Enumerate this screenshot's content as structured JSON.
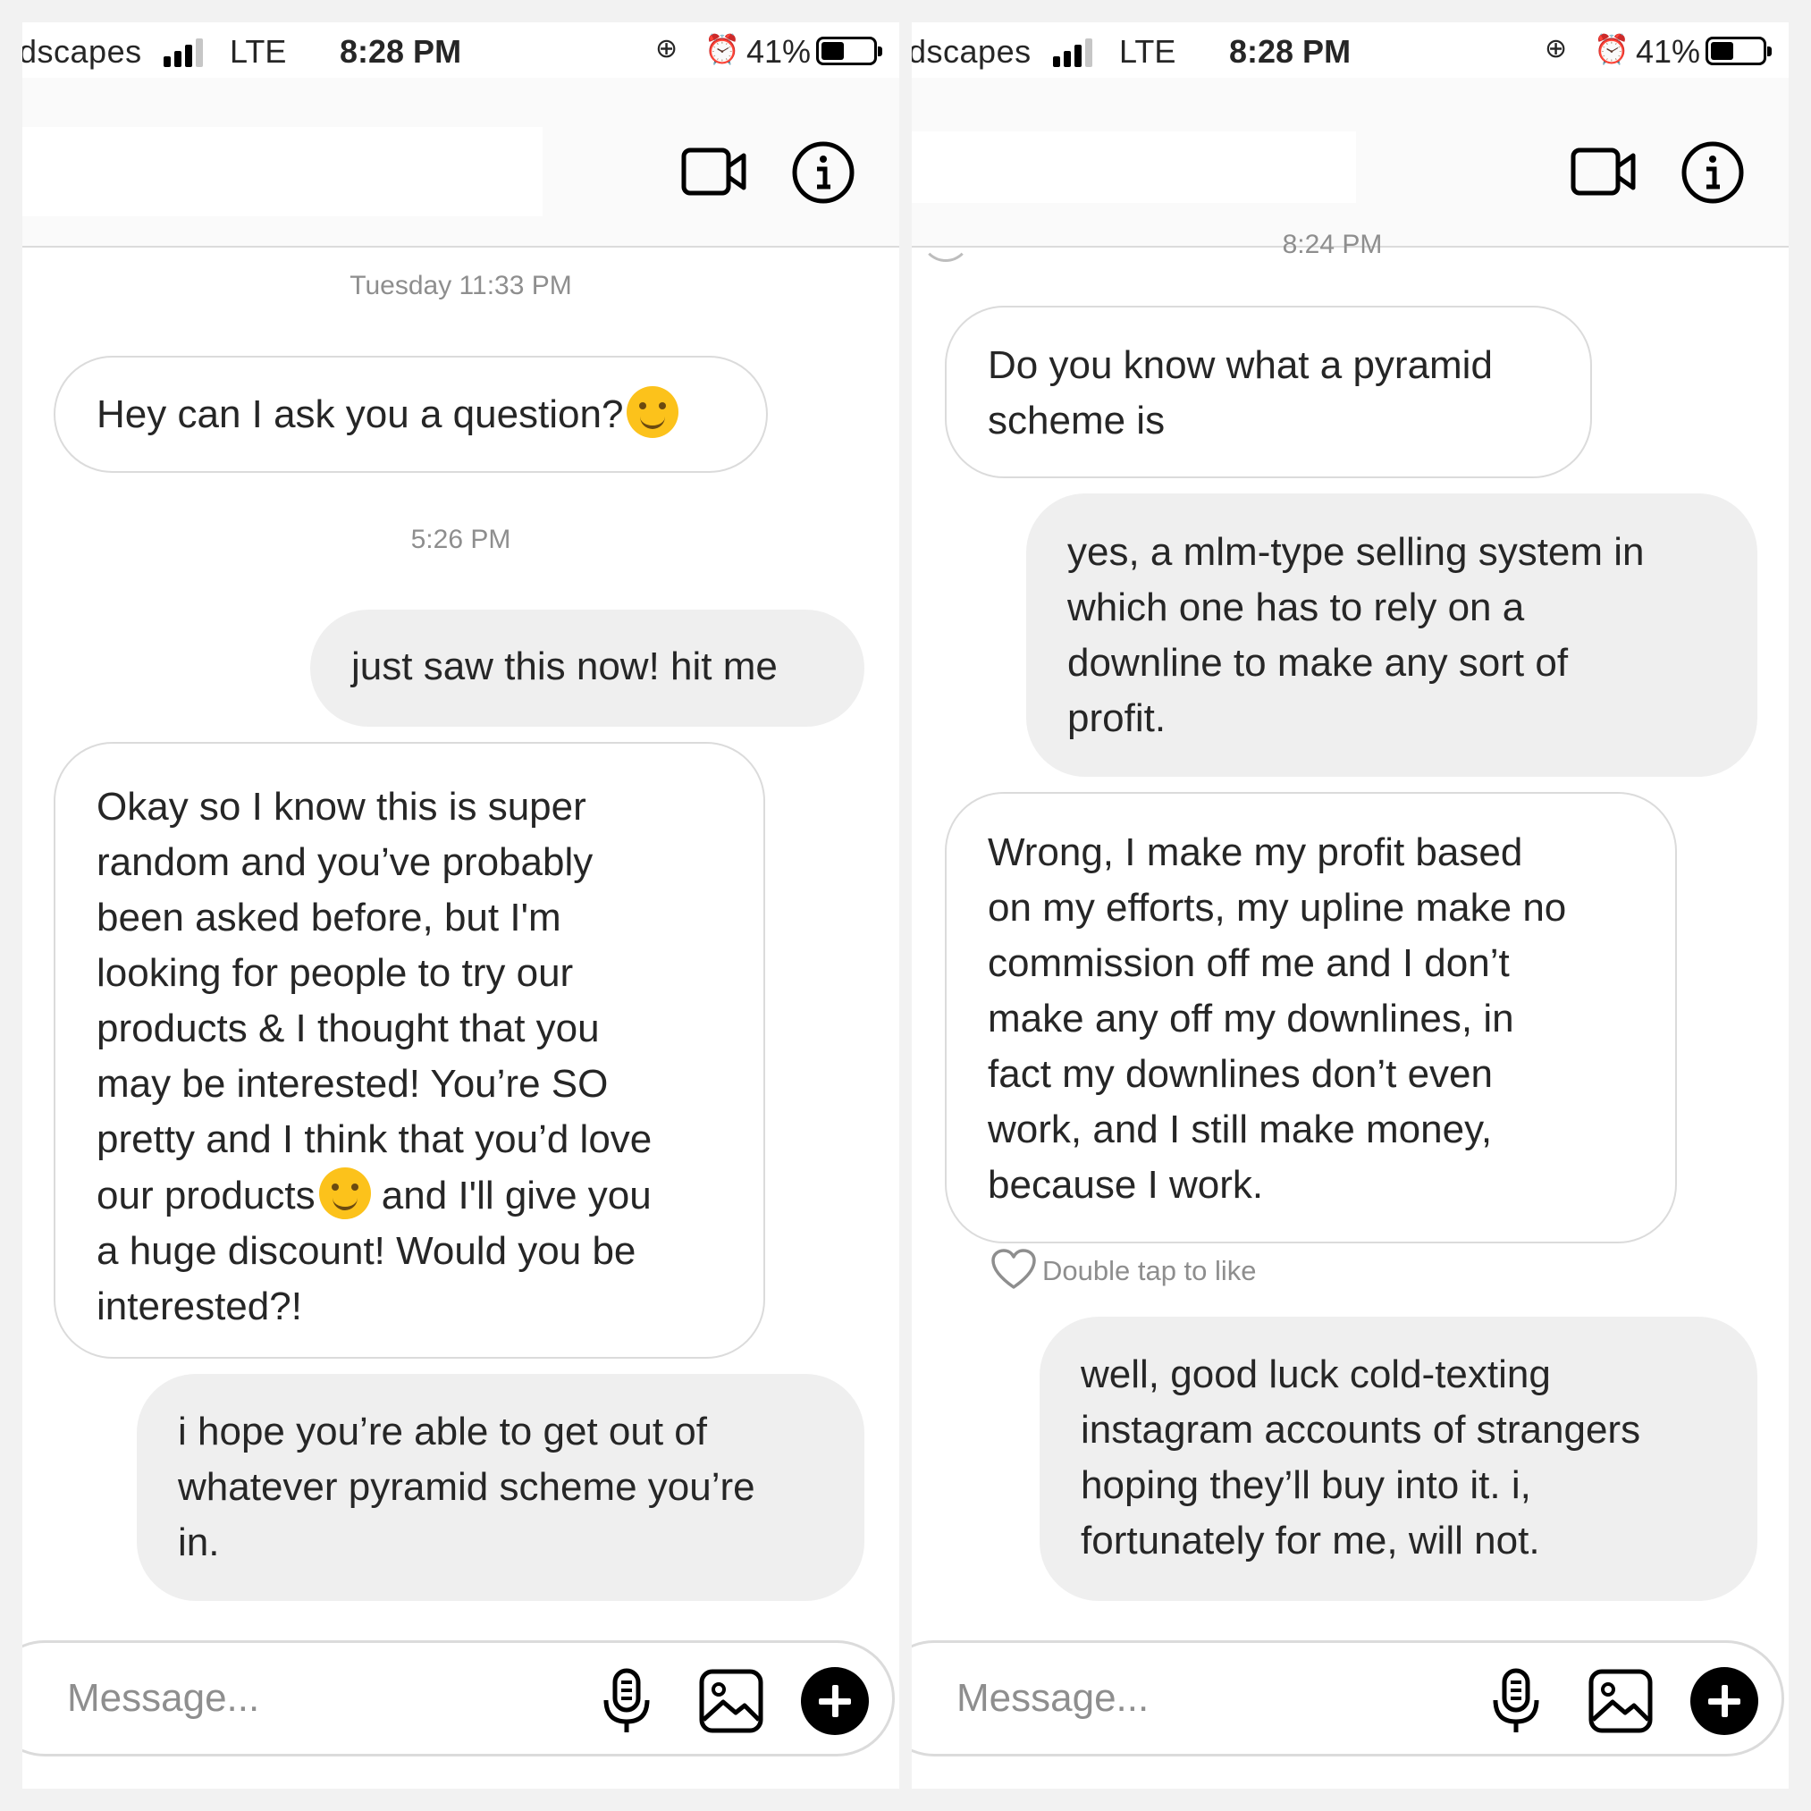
{
  "status_bar": {
    "carrier": "dscapes",
    "network": "LTE",
    "time": "8:28 PM",
    "battery_percent": "41%",
    "battery_level": 0.41,
    "icons": [
      "signal-icon",
      "orientation-lock-icon",
      "alarm-icon",
      "battery-icon"
    ]
  },
  "header": {
    "icons": [
      "video-call-icon",
      "info-icon"
    ]
  },
  "left_panel": {
    "timestamps": [
      "Tuesday 11:33 PM",
      "5:26 PM"
    ],
    "messages": [
      {
        "sender": "them",
        "lines": [
          "Hey can I ask you a question?"
        ],
        "emoji": "hugging-face-emoji"
      },
      {
        "sender": "me",
        "lines": [
          "just saw this now! hit me"
        ]
      },
      {
        "sender": "them",
        "lines": [
          "Okay so I know this is super",
          "random and you’ve probably",
          "been asked before, but I'm",
          "looking for people to try our",
          "products & I thought that you",
          "may be interested! You’re SO",
          "pretty and I think that you’d love",
          "our products",
          " and I'll give you",
          "a huge discount! Would you be",
          "interested?!"
        ],
        "emoji": "smiling-face-emoji"
      },
      {
        "sender": "me",
        "lines": [
          "i hope you’re able to get out of",
          "whatever pyramid scheme you’re",
          "in."
        ]
      }
    ]
  },
  "right_panel": {
    "timestamps": [
      "8:24 PM"
    ],
    "messages": [
      {
        "sender": "them",
        "lines": [
          "Do you know what a pyramid",
          "scheme is"
        ]
      },
      {
        "sender": "me",
        "lines": [
          "yes, a mlm-type selling system in",
          "which one has to rely on a",
          "downline to make any sort of",
          "profit."
        ]
      },
      {
        "sender": "them",
        "lines": [
          "Wrong, I make my profit based",
          "on my efforts, my upline make no",
          "commission off me and I don’t",
          "make any off my downlines, in",
          "fact my downlines don’t even",
          "work, and I still make money,",
          "because I work."
        ]
      },
      {
        "sender": "me",
        "lines": [
          "well, good luck cold-texting",
          "instagram accounts of strangers",
          "hoping they’ll buy into it. i,",
          "fortunately for me, will not."
        ]
      }
    ],
    "like_hint": "Double tap to like"
  },
  "composer": {
    "placeholder": "Message...",
    "value": "",
    "icons": [
      "microphone-icon",
      "gallery-icon",
      "plus-icon"
    ]
  },
  "colors": {
    "incoming_bubble": "#ffffff",
    "outgoing_bubble": "#efefef",
    "bubble_border": "#dbdbdb",
    "text": "#262626",
    "muted_text": "#8e8e8e",
    "emoji_yellow": "#fcc21b"
  }
}
